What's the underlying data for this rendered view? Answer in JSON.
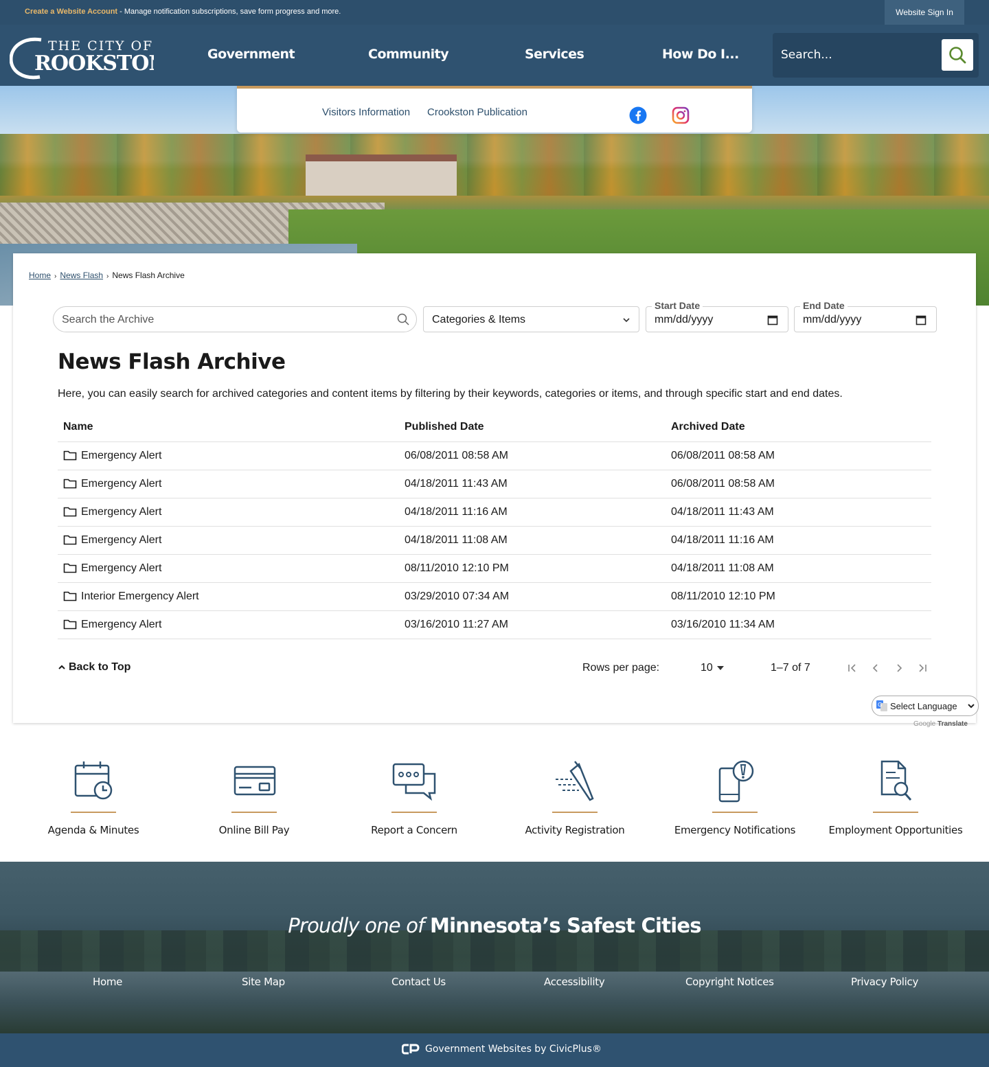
{
  "topbar": {
    "promo_accent": "Create a Website Account",
    "promo_text": " - Manage notification subscriptions, save form progress and more.",
    "signin_label": "Website Sign In"
  },
  "header": {
    "logo_line1": "THE CITY OF",
    "logo_line2": "ROOKSTON",
    "nav": [
      "Government",
      "Community",
      "Services",
      "How Do I..."
    ],
    "search_placeholder": "Search..."
  },
  "subnav": {
    "links": [
      "Visitors Information",
      "Crookston Publication"
    ],
    "social": [
      "facebook-icon",
      "instagram-icon"
    ]
  },
  "breadcrumb": {
    "home": "Home",
    "news": "News Flash",
    "current": "News Flash Archive"
  },
  "filters": {
    "search_placeholder": "Search the Archive",
    "category_value": "Categories & Items",
    "start_label": "Start Date",
    "start_value": "mm/dd/yyyy",
    "end_label": "End Date",
    "end_value": "mm/dd/yyyy"
  },
  "main": {
    "title": "News Flash Archive",
    "intro": "Here, you can easily search for archived categories and content items by filtering by their keywords, categories or items, and through specific start and end dates."
  },
  "table": {
    "headers": [
      "Name",
      "Published Date",
      "Archived Date"
    ],
    "rows": [
      {
        "name": "Emergency Alert",
        "published": "06/08/2011 08:58 AM",
        "archived": "06/08/2011 08:58 AM"
      },
      {
        "name": "Emergency Alert",
        "published": "04/18/2011 11:43 AM",
        "archived": "06/08/2011 08:58 AM"
      },
      {
        "name": "Emergency Alert",
        "published": "04/18/2011 11:16 AM",
        "archived": "04/18/2011 11:43 AM"
      },
      {
        "name": "Emergency Alert",
        "published": "04/18/2011 11:08 AM",
        "archived": "04/18/2011 11:16 AM"
      },
      {
        "name": "Emergency Alert",
        "published": "08/11/2010 12:10 PM",
        "archived": "04/18/2011 11:08 AM"
      },
      {
        "name": "Interior Emergency Alert",
        "published": "03/29/2010 07:34 AM",
        "archived": "08/11/2010 12:10 PM"
      },
      {
        "name": "Emergency Alert",
        "published": "03/16/2010 11:27 AM",
        "archived": "03/16/2010 11:34 AM"
      }
    ]
  },
  "pagination": {
    "back_to_top": "Back to Top",
    "rows_label": "Rows per page:",
    "rows_value": "10",
    "range": "1–7 of 7"
  },
  "translate": {
    "select_label": "Select Language",
    "powered_google": "Google",
    "powered_translate": "Translate"
  },
  "quick_links": [
    {
      "label": "Agenda & Minutes",
      "icon": "calendar-clock-icon"
    },
    {
      "label": "Online Bill Pay",
      "icon": "credit-card-icon"
    },
    {
      "label": "Report a Concern",
      "icon": "chat-bubbles-icon"
    },
    {
      "label": "Activity Registration",
      "icon": "pen-writing-icon"
    },
    {
      "label": "Emergency Notifications",
      "icon": "phone-alert-icon"
    },
    {
      "label": "Employment Opportunities",
      "icon": "document-search-icon"
    }
  ],
  "footer": {
    "tagline_italic": "Proudly one of",
    "tagline_bold": "Minnesota’s Safest Cities",
    "links": [
      "Home",
      "Site Map",
      "Contact Us",
      "Accessibility",
      "Copyright Notices",
      "Privacy Policy"
    ],
    "credit": "Government Websites by CivicPlus®"
  },
  "colors": {
    "header_blue": "#2f5270",
    "accent_gold": "#c89a5e",
    "search_green": "#5a8a2e"
  }
}
